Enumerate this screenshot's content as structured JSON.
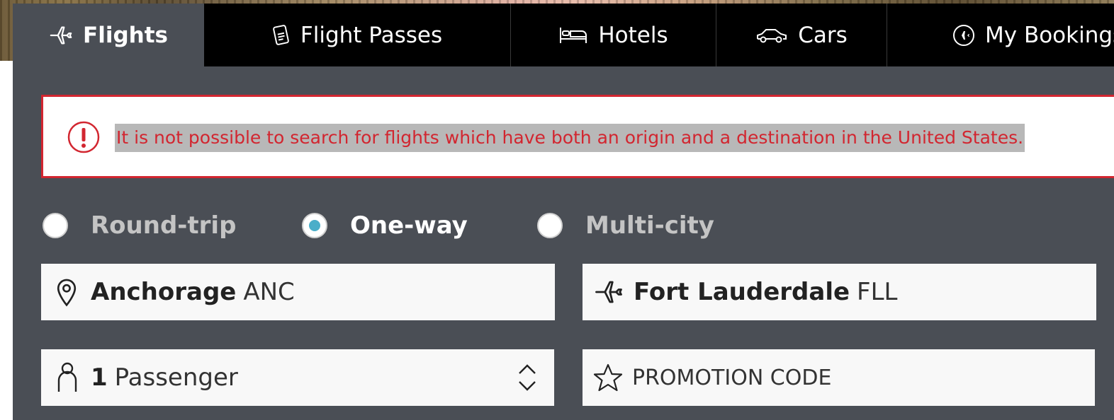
{
  "tabs": [
    {
      "label": "Flights",
      "icon": "airplane-icon",
      "active": true
    },
    {
      "label": "Flight Passes",
      "icon": "pass-icon",
      "active": false
    },
    {
      "label": "Hotels",
      "icon": "bed-icon",
      "active": false
    },
    {
      "label": "Cars",
      "icon": "car-icon",
      "active": false
    },
    {
      "label": "My Bookings",
      "icon": "plane-circle-icon",
      "active": false
    }
  ],
  "error": {
    "message": "It is not possible to search for flights which have both an origin and a destination in the United States.",
    "color": "#d22630"
  },
  "trip_type": {
    "options": [
      "Round-trip",
      "One-way",
      "Multi-city"
    ],
    "selected": "One-way",
    "accent": "#4aaec9"
  },
  "origin": {
    "city": "Anchorage",
    "code": "ANC"
  },
  "destination": {
    "city": "Fort Lauderdale",
    "code": "FLL"
  },
  "passengers": {
    "count": "1",
    "label": "Passenger"
  },
  "promo": {
    "placeholder": "PROMOTION CODE"
  },
  "colors": {
    "panel": "#4a4e55",
    "tabbar": "#000000",
    "field": "#f8f8f8"
  }
}
